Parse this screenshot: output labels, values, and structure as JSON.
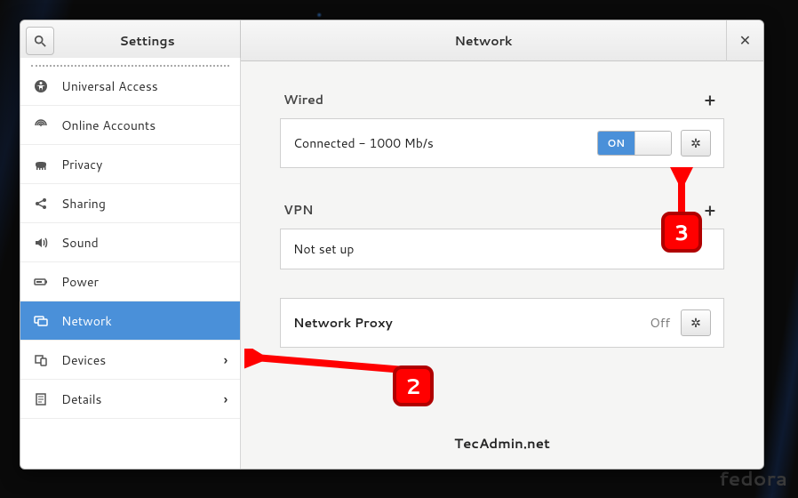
{
  "header": {
    "left_title": "Settings",
    "right_title": "Network"
  },
  "sidebar": {
    "items": [
      {
        "label": "Universal Access",
        "icon": "accessibility"
      },
      {
        "label": "Online Accounts",
        "icon": "online"
      },
      {
        "label": "Privacy",
        "icon": "privacy"
      },
      {
        "label": "Sharing",
        "icon": "share"
      },
      {
        "label": "Sound",
        "icon": "sound"
      },
      {
        "label": "Power",
        "icon": "power"
      },
      {
        "label": "Network",
        "icon": "network",
        "selected": true
      },
      {
        "label": "Devices",
        "icon": "devices",
        "chevron": true
      },
      {
        "label": "Details",
        "icon": "details",
        "chevron": true
      }
    ]
  },
  "network": {
    "wired_header": "Wired",
    "wired_status": "Connected - 1000 Mb/s",
    "wired_switch": "ON",
    "vpn_header": "VPN",
    "vpn_status": "Not set up",
    "proxy_label": "Network Proxy",
    "proxy_status": "Off"
  },
  "annotations": {
    "step2": "2",
    "step3": "3"
  },
  "watermark": "TecAdmin.net",
  "brand": "fedora"
}
